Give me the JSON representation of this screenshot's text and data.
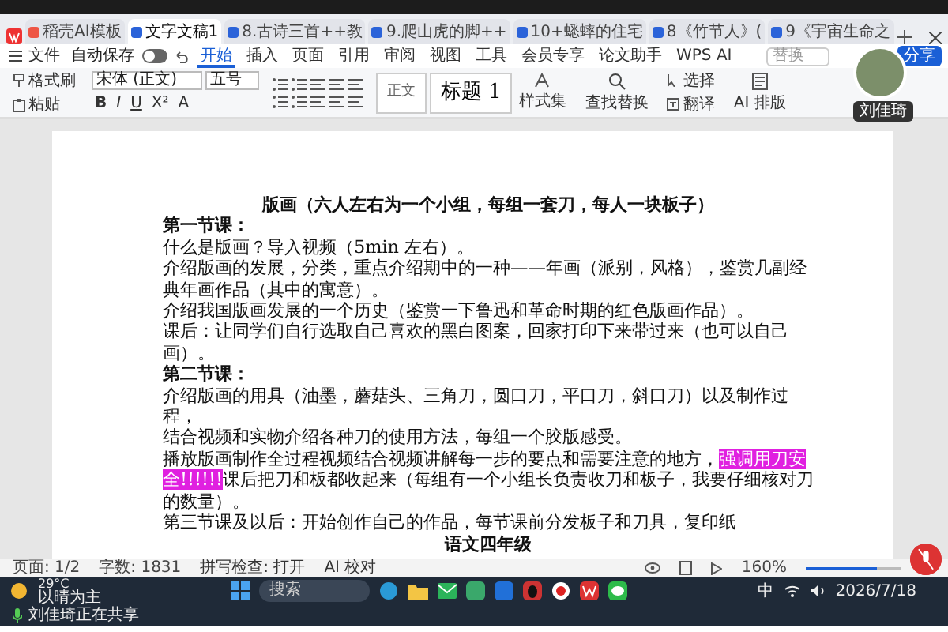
{
  "doc_tabs": [
    {
      "label": "稻壳AI模板",
      "kind": "docer",
      "selected": false
    },
    {
      "label": "文字文稿1",
      "kind": "doc",
      "selected": true
    },
    {
      "label": "8.古诗三首++教",
      "kind": "doc",
      "selected": false
    },
    {
      "label": "9.爬山虎的脚++",
      "kind": "doc",
      "selected": false
    },
    {
      "label": "10+蟋蟀的住宅",
      "kind": "doc",
      "selected": false
    },
    {
      "label": "8《竹节人》(",
      "kind": "doc",
      "selected": false
    },
    {
      "label": "9《宇宙生命之",
      "kind": "doc",
      "selected": false
    }
  ],
  "menu": {
    "file": "文件",
    "autosave": {
      "label": "自动保存",
      "on": false
    },
    "tabs": [
      {
        "label": "开始",
        "selected": true
      },
      {
        "label": "插入",
        "selected": false
      },
      {
        "label": "页面",
        "selected": false
      },
      {
        "label": "引用",
        "selected": false
      },
      {
        "label": "审阅",
        "selected": false
      },
      {
        "label": "视图",
        "selected": false
      },
      {
        "label": "工具",
        "selected": false
      },
      {
        "label": "会员专享",
        "selected": false
      },
      {
        "label": "论文助手",
        "selected": false
      },
      {
        "label": "WPS AI",
        "selected": false
      }
    ],
    "search_placeholder": "替换",
    "share": "分享"
  },
  "ribbon": {
    "format_painter": "格式刷",
    "paste": "粘贴",
    "font": "宋体 (正文)",
    "size": "五号",
    "format_glyphs": [
      "B",
      "I",
      "U",
      "X²",
      "A"
    ],
    "styles": [
      {
        "label": "正文",
        "kind": "normal"
      },
      {
        "label": "标题 1",
        "kind": "heading"
      }
    ],
    "style_set": "样式集",
    "find_replace": "查找替换",
    "select": "选择",
    "translate": "翻译",
    "ai_layout": "AI 排版"
  },
  "presenter": {
    "name": "刘佳琦"
  },
  "document": {
    "paragraphs": [
      {
        "kind": "title",
        "runs": [
          {
            "text": "版画（六人左右为一个小组，每组一套刀，每人一块板子）",
            "highlight": false
          }
        ]
      },
      {
        "kind": "heading",
        "runs": [
          {
            "text": "第一节课：",
            "highlight": false
          }
        ]
      },
      {
        "kind": "text",
        "runs": [
          {
            "text": "什么是版画？导入视频（5min 左右）。",
            "highlight": false
          }
        ]
      },
      {
        "kind": "text",
        "runs": [
          {
            "text": "介绍版画的发展，分类，重点介绍期中的一种——年画（派别，风格），鉴赏几副经典年画作品（其中的寓意）。",
            "highlight": false
          }
        ]
      },
      {
        "kind": "text",
        "runs": [
          {
            "text": "介绍我国版画发展的一个历史（鉴赏一下鲁迅和革命时期的红色版画作品）。",
            "highlight": false
          }
        ]
      },
      {
        "kind": "text",
        "runs": [
          {
            "text": "课后：让同学们自行选取自己喜欢的黑白图案，回家打印下来带过来（也可以自己画）。",
            "highlight": false
          }
        ]
      },
      {
        "kind": "heading",
        "runs": [
          {
            "text": "第二节课：",
            "highlight": false
          }
        ]
      },
      {
        "kind": "text",
        "runs": [
          {
            "text": "介绍版画的用具（油墨，蘑菇头、三角刀，圆口刀，平口刀，斜口刀）以及制作过程，",
            "highlight": false
          }
        ]
      },
      {
        "kind": "text",
        "runs": [
          {
            "text": "结合视频和实物介绍各种刀的使用方法，每组一个胶版感受。",
            "highlight": false
          }
        ]
      },
      {
        "kind": "text",
        "runs": [
          {
            "text": "播放版画制作全过程视频结合视频讲解每一步的要点和需要注意的地方，",
            "highlight": false
          },
          {
            "text": "强调用刀安全!!!!!!",
            "highlight": true
          },
          {
            "text": "课后把刀和板都收起来（每组有一个小组长负责收刀和板子，我要仔细核对刀的数量）。",
            "highlight": false
          }
        ]
      },
      {
        "kind": "text",
        "runs": [
          {
            "text": "第三节课及以后：开始创作自己的作品，每节课前分发板子和刀具，复印纸",
            "highlight": false
          }
        ]
      },
      {
        "kind": "title",
        "runs": [
          {
            "text": "语文四年级",
            "highlight": false
          }
        ]
      }
    ]
  },
  "status_bar": {
    "page": "页面: 1/2",
    "words": "字数: 1831",
    "spell": "拼写检查: 打开",
    "ai_check": "AI 校对",
    "zoom": "160%",
    "zoom_slider": {
      "level": 0.75
    }
  },
  "taskbar": {
    "temperature": "29°C",
    "weather": "以晴为主",
    "search_placeholder": "搜索",
    "ime": "中",
    "date": "2026/7/18"
  },
  "sharing": {
    "text": "刘佳琦正在共享"
  }
}
